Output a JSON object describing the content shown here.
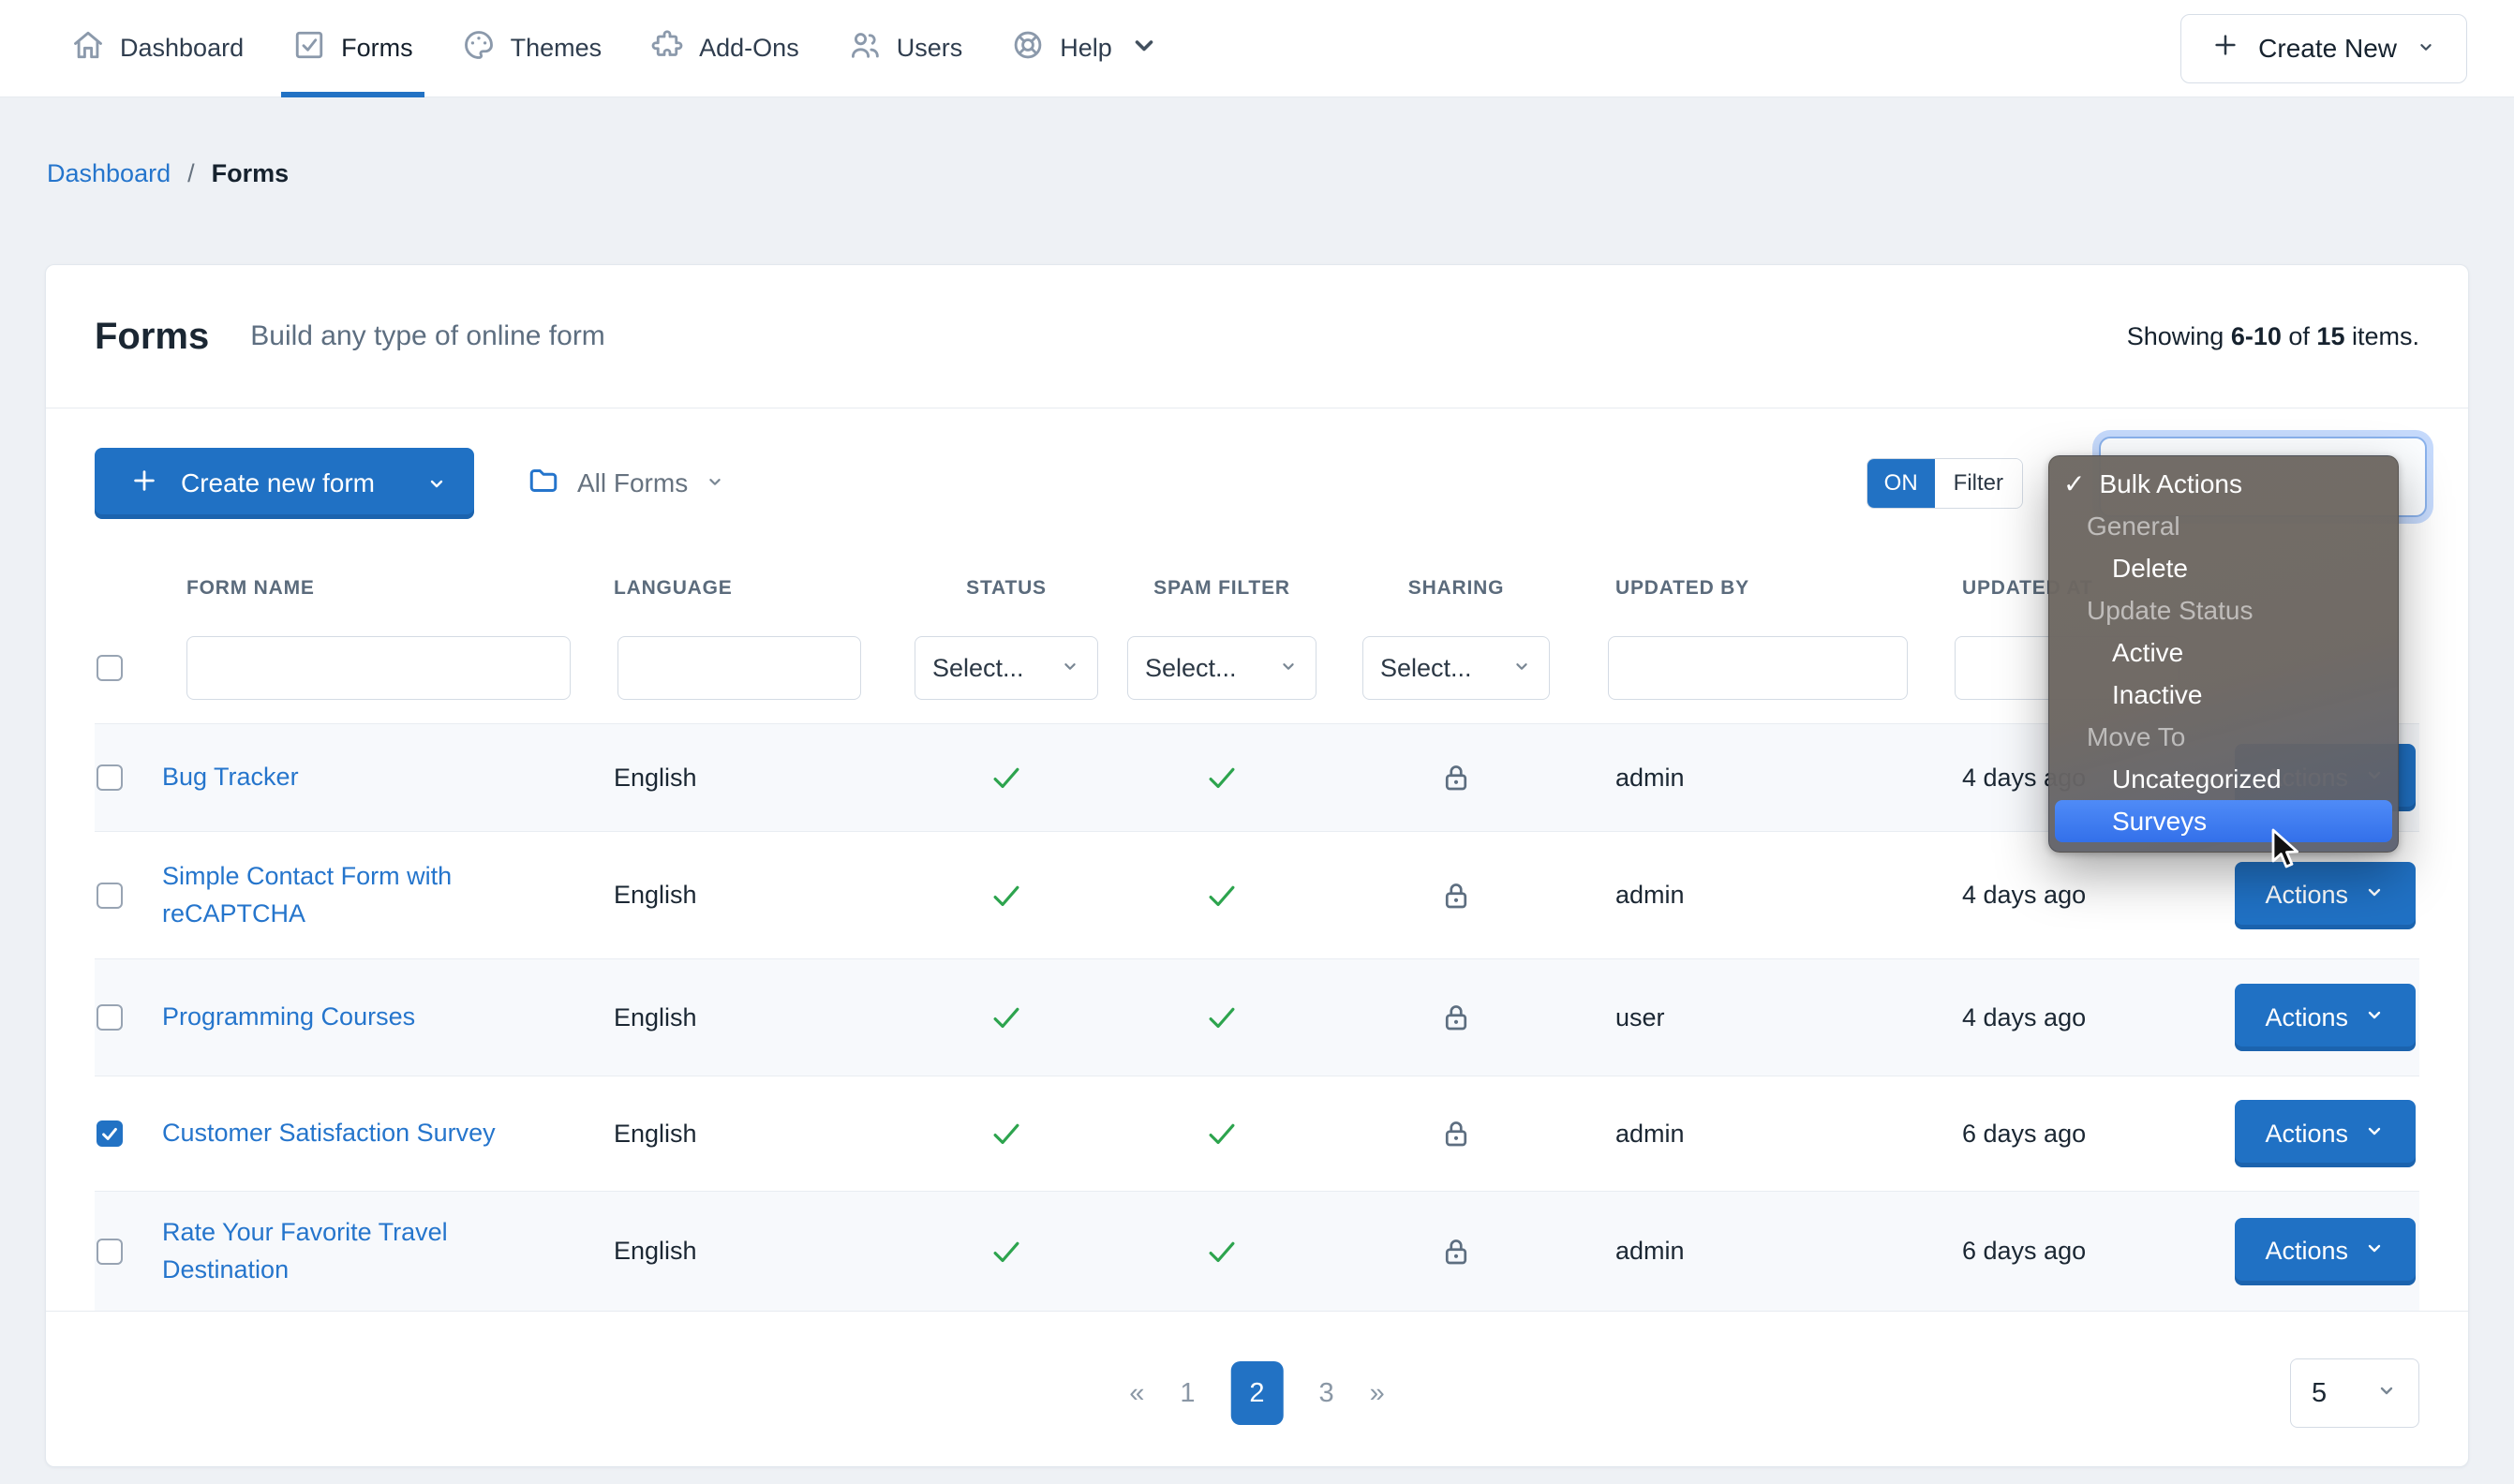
{
  "nav": {
    "items": [
      {
        "label": "Dashboard",
        "icon": "home-icon",
        "active": false
      },
      {
        "label": "Forms",
        "icon": "check-square-icon",
        "active": true
      },
      {
        "label": "Themes",
        "icon": "palette-icon",
        "active": false
      },
      {
        "label": "Add-Ons",
        "icon": "puzzle-icon",
        "active": false
      },
      {
        "label": "Users",
        "icon": "users-icon",
        "active": false
      },
      {
        "label": "Help",
        "icon": "lifebuoy-icon",
        "active": false,
        "has_chevron": true
      }
    ],
    "create_new": "Create New"
  },
  "breadcrumb": {
    "link": "Dashboard",
    "separator": "/",
    "current": "Forms"
  },
  "header": {
    "title": "Forms",
    "subtitle": "Build any type of online form",
    "showing": {
      "prefix": "Showing",
      "range": "6-10",
      "of": "of",
      "total": "15",
      "suffix": "items."
    }
  },
  "toolbar": {
    "create_form": "Create new form",
    "folder_filter": "All Forms",
    "toggle_on": "ON",
    "toggle_label": "Filter",
    "bulk_select_value": "Bulk Actions"
  },
  "menu": {
    "check_glyph": "✓",
    "items": [
      {
        "label": "Bulk Actions",
        "type": "selected"
      },
      {
        "label": "General",
        "type": "group"
      },
      {
        "label": "Delete",
        "type": "option"
      },
      {
        "label": "Update Status",
        "type": "group"
      },
      {
        "label": "Active",
        "type": "option"
      },
      {
        "label": "Inactive",
        "type": "option"
      },
      {
        "label": "Move To",
        "type": "group"
      },
      {
        "label": "Uncategorized",
        "type": "option"
      },
      {
        "label": "Surveys",
        "type": "option",
        "highlighted": true
      }
    ]
  },
  "table": {
    "headers": {
      "name": "FORM NAME",
      "language": "LANGUAGE",
      "status": "STATUS",
      "spam": "SPAM FILTER",
      "sharing": "SHARING",
      "updated_by": "UPDATED BY",
      "updated_at": "UPDATED AT"
    },
    "filters": {
      "select_placeholder": "Select..."
    },
    "rows": [
      {
        "name": "Bug Tracker",
        "language": "English",
        "status": true,
        "spam_filter": true,
        "sharing": "locked",
        "updated_by": "admin",
        "updated_at": "4 days ago",
        "checked": false,
        "actions": "Actions"
      },
      {
        "name": "Simple Contact Form with reCAPTCHA",
        "language": "English",
        "status": true,
        "spam_filter": true,
        "sharing": "locked",
        "updated_by": "admin",
        "updated_at": "4 days ago",
        "checked": false,
        "actions": "Actions"
      },
      {
        "name": "Programming Courses",
        "language": "English",
        "status": true,
        "spam_filter": true,
        "sharing": "locked",
        "updated_by": "user",
        "updated_at": "4 days ago",
        "checked": false,
        "actions": "Actions"
      },
      {
        "name": "Customer Satisfaction Survey",
        "language": "English",
        "status": true,
        "spam_filter": true,
        "sharing": "locked",
        "updated_by": "admin",
        "updated_at": "6 days ago",
        "checked": true,
        "actions": "Actions"
      },
      {
        "name": "Rate Your Favorite Travel Destination",
        "language": "English",
        "status": true,
        "spam_filter": true,
        "sharing": "locked",
        "updated_by": "admin",
        "updated_at": "6 days ago",
        "checked": false,
        "actions": "Actions"
      }
    ]
  },
  "pagination": {
    "first": "«",
    "last": "»",
    "pages": [
      "1",
      "2",
      "3"
    ],
    "current_page": "2",
    "per_page": "5"
  },
  "colors": {
    "accent_blue": "#2272c4",
    "link_blue": "#2575cc",
    "success_green": "#2da44e",
    "menu_bg": "#6e6862",
    "menu_highlight": "#4080f0",
    "page_bg": "#eef1f5"
  }
}
